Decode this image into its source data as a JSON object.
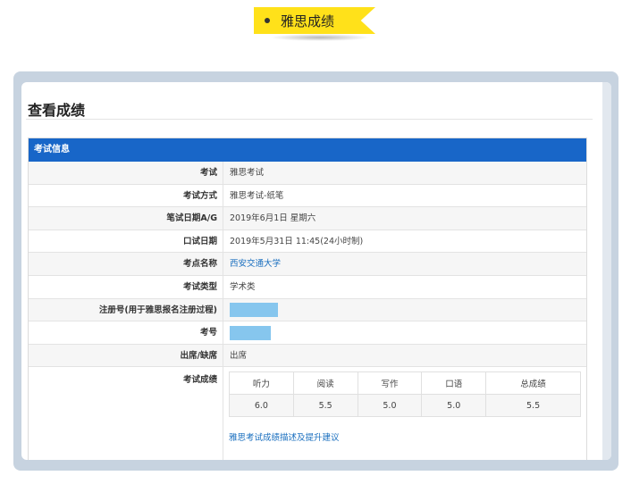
{
  "banner": {
    "title": "雅思成绩"
  },
  "page": {
    "title": "查看成绩"
  },
  "panel": {
    "header": "考试信息",
    "rows": [
      {
        "label": "考试",
        "value": "雅思考试"
      },
      {
        "label": "考试方式",
        "value": "雅思考试-纸笔"
      },
      {
        "label": "笔试日期A/G",
        "value": "2019年6月1日 星期六"
      },
      {
        "label": "口试日期",
        "value": "2019年5月31日 11:45(24小时制)"
      },
      {
        "label": "考点名称",
        "value": "西安交通大学"
      },
      {
        "label": "考试类型",
        "value": "学术类"
      },
      {
        "label": "注册号(用于雅思报名注册过程)",
        "value": ""
      },
      {
        "label": "考号",
        "value": ""
      },
      {
        "label": "出席/缺席",
        "value": "出席"
      }
    ],
    "scores_label": "考试成绩",
    "score_headers": [
      "听力",
      "阅读",
      "写作",
      "口语",
      "总成绩"
    ],
    "score_values": [
      "6.0",
      "5.5",
      "5.0",
      "5.0",
      "5.5"
    ],
    "score_link": "雅思考试成绩描述及提升建议"
  },
  "colors": {
    "banner": "#ffe11a",
    "panel_header": "#1866c8",
    "link": "#1a6fbf",
    "redaction": "#86c6ee",
    "frame": "#c7d3e0"
  }
}
